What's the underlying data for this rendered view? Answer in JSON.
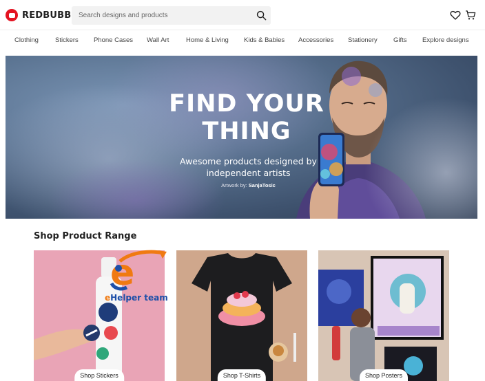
{
  "brand": {
    "name": "REDBUBBLE"
  },
  "search": {
    "placeholder": "Search designs and products"
  },
  "nav": {
    "items": [
      {
        "label": "Clothing"
      },
      {
        "label": "Stickers"
      },
      {
        "label": "Phone Cases"
      },
      {
        "label": "Wall Art"
      },
      {
        "label": "Home & Living"
      },
      {
        "label": "Kids & Babies"
      },
      {
        "label": "Accessories"
      },
      {
        "label": "Stationery"
      },
      {
        "label": "Gifts"
      },
      {
        "label": "Explore designs"
      }
    ]
  },
  "hero": {
    "title_line1": "FIND YOUR",
    "title_line2": "THING",
    "subtitle_line1": "Awesome products designed by",
    "subtitle_line2": "independent artists",
    "credit_prefix": "Artwork by:",
    "credit_artist": "SanjaTosic"
  },
  "section": {
    "title": "Shop Product Range"
  },
  "products": [
    {
      "label": "Shop Stickers"
    },
    {
      "label": "Shop T-Shirts"
    },
    {
      "label": "Shop Posters"
    }
  ],
  "watermark": {
    "text_prefix": "",
    "text_e": "e",
    "text_rest": "Helper team"
  },
  "colors": {
    "brand_red": "#e41321",
    "hero_blue": "#5c7593",
    "watermark_blue": "#1d4fa8",
    "watermark_orange": "#f07a12"
  },
  "icons": {
    "search": "search-icon",
    "wishlist": "heart-icon",
    "cart": "cart-icon"
  }
}
